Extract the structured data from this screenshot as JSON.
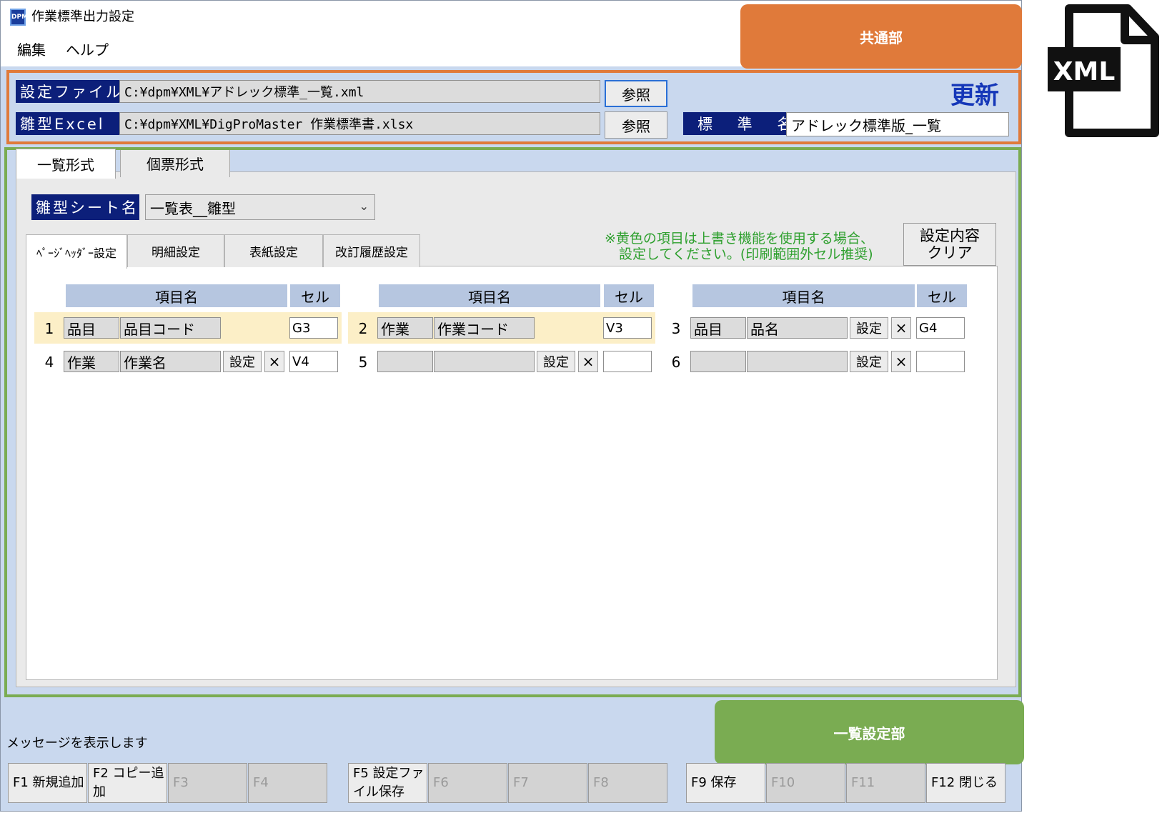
{
  "window": {
    "title": "作業標準出力設定",
    "icon_text": "DPM"
  },
  "menu": [
    "編集",
    "ヘルプ"
  ],
  "callouts": {
    "common": "共通部",
    "list_settings": "一覧設定部"
  },
  "header": {
    "settings_file_label": "設定ファイル",
    "settings_file_path": "C:¥dpm¥XML¥アドレック標準_一覧.xml",
    "template_label": "雛型Excel",
    "template_path": "C:¥dpm¥XML¥DigProMaster 作業標準書.xlsx",
    "browse_label": "参照",
    "update_label": "更新",
    "standard_name_label": "標 準 名",
    "standard_name_value": "アドレック標準版_一覧"
  },
  "outer_tabs": [
    "一覧形式",
    "個票形式"
  ],
  "sheet": {
    "label": "雛型シート名",
    "value": "一覧表__雛型"
  },
  "inner_tabs": [
    "ﾍﾟｰｼﾞﾍｯﾀﾞｰ設定",
    "明細設定",
    "表紙設定",
    "改訂履歴設定"
  ],
  "note": {
    "line1": "※黄色の項目は上書き機能を使用する場合、",
    "line2": "設定してください。(印刷範囲外セル推奨)"
  },
  "clear_button": {
    "line1": "設定内容",
    "line2": "クリア"
  },
  "table": {
    "col_item": "項目名",
    "col_cell": "セル",
    "set_label": "設定",
    "x_label": "×",
    "rows": [
      {
        "no": "1",
        "a": "品目",
        "b": "品目コード",
        "cell": "G3",
        "highlight": true,
        "buttons": false
      },
      {
        "no": "2",
        "a": "作業",
        "b": "作業コード",
        "cell": "V3",
        "highlight": true,
        "buttons": false
      },
      {
        "no": "3",
        "a": "品目",
        "b": "品名",
        "cell": "G4",
        "highlight": false,
        "buttons": true
      },
      {
        "no": "4",
        "a": "作業",
        "b": "作業名",
        "cell": "V4",
        "highlight": false,
        "buttons": true
      },
      {
        "no": "5",
        "a": "",
        "b": "",
        "cell": "",
        "highlight": false,
        "buttons": true
      },
      {
        "no": "6",
        "a": "",
        "b": "",
        "cell": "",
        "highlight": false,
        "buttons": true
      }
    ]
  },
  "status_message": "メッセージを表示します",
  "fkeys": [
    {
      "label": "F1 新規追加",
      "enabled": true
    },
    {
      "label": "F2 コピー追加",
      "enabled": true
    },
    {
      "label": "F3",
      "enabled": false
    },
    {
      "label": "F4",
      "enabled": false
    },
    {
      "label": "F5 設定ファイル保存",
      "enabled": true
    },
    {
      "label": "F6",
      "enabled": false
    },
    {
      "label": "F7",
      "enabled": false
    },
    {
      "label": "F8",
      "enabled": false
    },
    {
      "label": "F9 保存",
      "enabled": true
    },
    {
      "label": "F10",
      "enabled": false
    },
    {
      "label": "F11",
      "enabled": false
    },
    {
      "label": "F12 閉じる",
      "enabled": true
    }
  ],
  "xml_icon_text": "XML"
}
